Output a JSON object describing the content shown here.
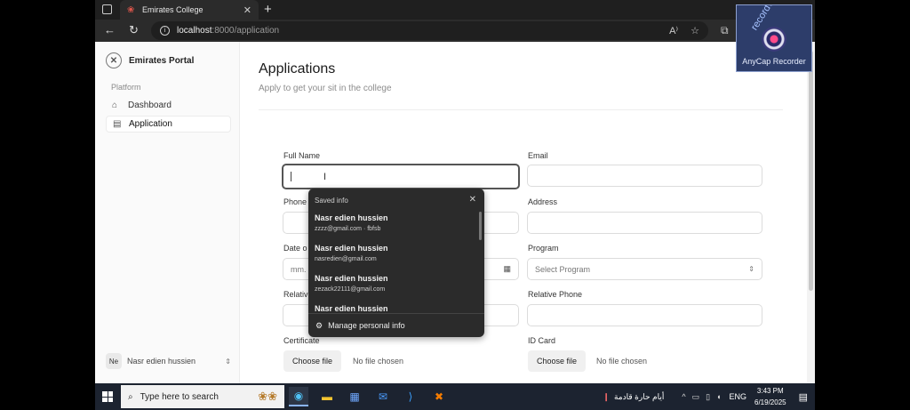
{
  "browser": {
    "tab_title": "Emirates College",
    "tab_close": "✕",
    "new_tab": "+",
    "back": "←",
    "reload": "↻",
    "url_host": "localhost",
    "url_path": ":8000/application",
    "read_aloud": "A⁾",
    "favorite": "☆",
    "extensions": "⧉"
  },
  "recorder": {
    "watermark": "recordvideocall.com",
    "title": "AnyCap Recorder"
  },
  "sidebar": {
    "brand": "Emirates Portal",
    "group": "Platform",
    "items": [
      {
        "label": "Dashboard",
        "icon": "⌂"
      },
      {
        "label": "Application",
        "icon": "▤"
      }
    ],
    "user_initials": "Ne",
    "user_name": "Nasr edien hussien",
    "user_chevron": "⇕"
  },
  "page": {
    "title": "Applications",
    "subtitle": "Apply to get your sit in the college"
  },
  "form": {
    "full_name_label": "Full Name",
    "email_label": "Email",
    "phone_label": "Phone",
    "address_label": "Address",
    "date_label": "Date o",
    "date_placeholder": "mm.",
    "program_label": "Program",
    "program_value": "Select Program",
    "relative_label": "Relativ",
    "relative_phone_label": "Relative Phone",
    "certificate_label": "Certificate",
    "id_card_label": "ID Card",
    "choose_file": "Choose file",
    "no_file": "No file chosen"
  },
  "autofill": {
    "title": "Saved info",
    "close": "✕",
    "entries": [
      {
        "name": "Nasr edien hussien",
        "detail": "zzzz@gmail.com · fbfsb"
      },
      {
        "name": "Nasr edien hussien",
        "detail": "nasredien@gmail.com"
      },
      {
        "name": "Nasr edien hussien",
        "detail": "zezack22111@gmail.com"
      },
      {
        "name": "Nasr edien hussien",
        "detail": ""
      }
    ],
    "manage": "Manage personal info"
  },
  "taskbar": {
    "search_placeholder": "Type here to search",
    "weather_text": "أيام حارة قادمة",
    "language": "ENG",
    "time": "3:43 PM",
    "date": "6/19/2025"
  }
}
